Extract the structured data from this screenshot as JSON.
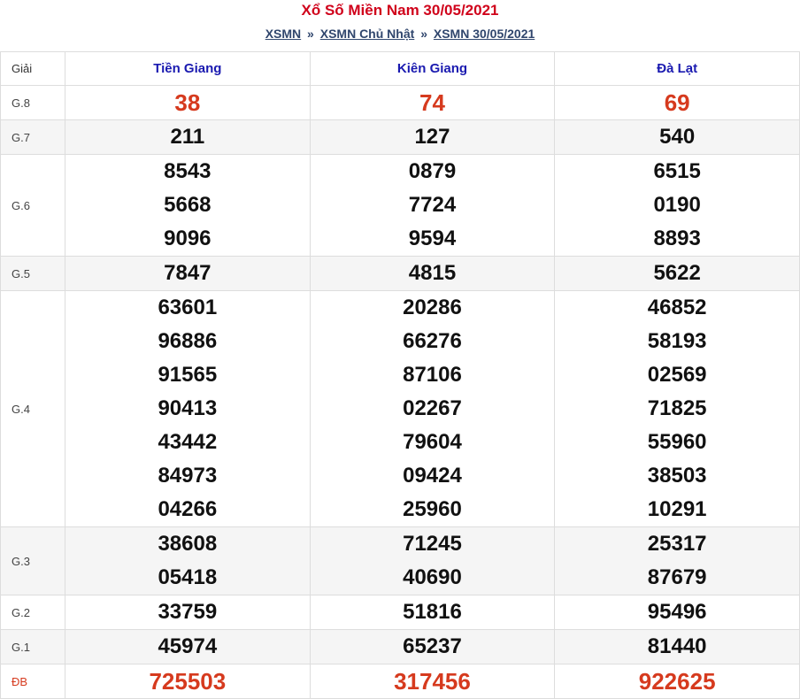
{
  "header": {
    "title": "Xổ Số Miền Nam 30/05/2021",
    "breadcrumb": [
      {
        "label": "XSMN"
      },
      {
        "label": "XSMN Chủ Nhật"
      },
      {
        "label": "XSMN 30/05/2021"
      }
    ],
    "separator": "»"
  },
  "table": {
    "label_header": "Giải",
    "provinces": [
      "Tiền Giang",
      "Kiên Giang",
      "Đà Lạt"
    ],
    "rows": [
      {
        "label": "G.8",
        "values": [
          [
            "38"
          ],
          [
            "74"
          ],
          [
            "69"
          ]
        ]
      },
      {
        "label": "G.7",
        "values": [
          [
            "211"
          ],
          [
            "127"
          ],
          [
            "540"
          ]
        ]
      },
      {
        "label": "G.6",
        "values": [
          [
            "8543",
            "5668",
            "9096"
          ],
          [
            "0879",
            "7724",
            "9594"
          ],
          [
            "6515",
            "0190",
            "8893"
          ]
        ]
      },
      {
        "label": "G.5",
        "values": [
          [
            "7847"
          ],
          [
            "4815"
          ],
          [
            "5622"
          ]
        ]
      },
      {
        "label": "G.4",
        "values": [
          [
            "63601",
            "96886",
            "91565",
            "90413",
            "43442",
            "84973",
            "04266"
          ],
          [
            "20286",
            "66276",
            "87106",
            "02267",
            "79604",
            "09424",
            "25960"
          ],
          [
            "46852",
            "58193",
            "02569",
            "71825",
            "55960",
            "38503",
            "10291"
          ]
        ]
      },
      {
        "label": "G.3",
        "values": [
          [
            "38608",
            "05418"
          ],
          [
            "71245",
            "40690"
          ],
          [
            "25317",
            "87679"
          ]
        ]
      },
      {
        "label": "G.2",
        "values": [
          [
            "33759"
          ],
          [
            "51816"
          ],
          [
            "95496"
          ]
        ]
      },
      {
        "label": "G.1",
        "values": [
          [
            "45974"
          ],
          [
            "65237"
          ],
          [
            "81440"
          ]
        ]
      },
      {
        "label": "ĐB",
        "values": [
          [
            "725503"
          ],
          [
            "317456"
          ],
          [
            "922625"
          ]
        ]
      }
    ]
  }
}
